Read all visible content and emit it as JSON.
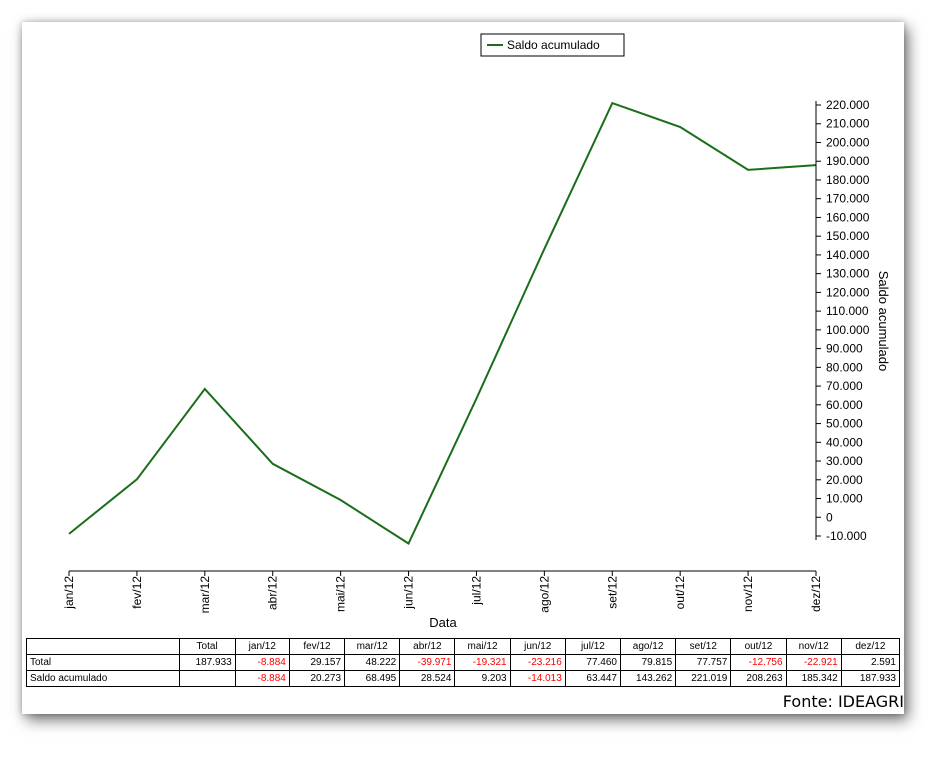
{
  "source_label": "Fonte: IDEAGRI",
  "colors": {
    "series": "#1a6e1a",
    "negative": "#ff0000",
    "axis": "#000000"
  },
  "chart_data": {
    "type": "line",
    "x": [
      "jan/12",
      "fev/12",
      "mar/12",
      "abr/12",
      "mai/12",
      "jun/12",
      "jul/12",
      "ago/12",
      "set/12",
      "out/12",
      "nov/12",
      "dez/12"
    ],
    "series": [
      {
        "name": "Saldo acumulado",
        "values": [
          -8884,
          20273,
          68495,
          28524,
          9203,
          -14013,
          63447,
          143262,
          221019,
          208263,
          185342,
          187933
        ]
      }
    ],
    "xlabel": "Data",
    "ylabel": "Saldo acumulado",
    "ylim": [
      -10000,
      220000
    ],
    "y_axis_position": "right",
    "y_ticks": [
      -10000,
      0,
      10000,
      20000,
      30000,
      40000,
      50000,
      60000,
      70000,
      80000,
      90000,
      100000,
      110000,
      120000,
      130000,
      140000,
      150000,
      160000,
      170000,
      180000,
      190000,
      200000,
      210000,
      220000
    ],
    "y_tick_labels": [
      "-10.000",
      "0",
      "10.000",
      "20.000",
      "30.000",
      "40.000",
      "50.000",
      "60.000",
      "70.000",
      "80.000",
      "90.000",
      "100.000",
      "110.000",
      "120.000",
      "130.000",
      "140.000",
      "150.000",
      "160.000",
      "170.000",
      "180.000",
      "190.000",
      "200.000",
      "210.000",
      "220.000"
    ],
    "legend": {
      "position": "top-center",
      "entries": [
        "Saldo acumulado"
      ]
    },
    "grid": false
  },
  "table": {
    "headers": [
      "",
      "Total",
      "jan/12",
      "fev/12",
      "mar/12",
      "abr/12",
      "mai/12",
      "jun/12",
      "jul/12",
      "ago/12",
      "set/12",
      "out/12",
      "nov/12",
      "dez/12"
    ],
    "rows": [
      {
        "label": "Total",
        "total": "187.933",
        "cells": [
          "-8.884",
          "29.157",
          "48.222",
          "-39.971",
          "-19.321",
          "-23.216",
          "77.460",
          "79.815",
          "77.757",
          "-12.756",
          "-22.921",
          "2.591"
        ]
      },
      {
        "label": "Saldo acumulado",
        "total": "",
        "cells": [
          "-8.884",
          "20.273",
          "68.495",
          "28.524",
          "9.203",
          "-14.013",
          "63.447",
          "143.262",
          "221.019",
          "208.263",
          "185.342",
          "187.933"
        ]
      }
    ]
  }
}
